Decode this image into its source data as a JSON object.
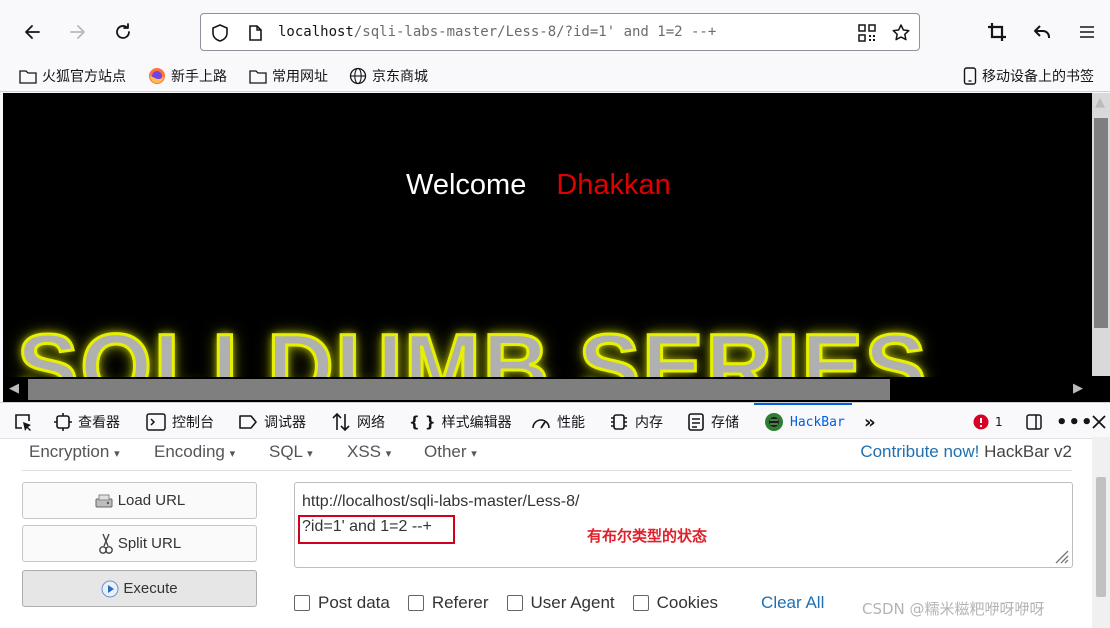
{
  "browser": {
    "url_host": "localhost",
    "url_path": "/sqli-labs-master/Less-8/?id=1' and 1=2 --+"
  },
  "bookmarks": [
    {
      "label": "火狐官方站点",
      "icon": "folder-icon"
    },
    {
      "label": "新手上路",
      "icon": "firefox-icon"
    },
    {
      "label": "常用网址",
      "icon": "folder-icon"
    },
    {
      "label": "京东商城",
      "icon": "globe-icon"
    }
  ],
  "mobile_bookmarks": "移动设备上的书签",
  "page": {
    "welcome": "Welcome",
    "name": "Dhakkan",
    "banner": "SQLI DUMB SERIES"
  },
  "devtools": {
    "tabs": [
      {
        "label": "查看器",
        "icon": "inspector-icon"
      },
      {
        "label": "控制台",
        "icon": "console-icon"
      },
      {
        "label": "调试器",
        "icon": "debugger-icon"
      },
      {
        "label": "网络",
        "icon": "network-icon"
      },
      {
        "label": "样式编辑器",
        "icon": "style-editor-icon"
      },
      {
        "label": "性能",
        "icon": "performance-icon"
      },
      {
        "label": "内存",
        "icon": "memory-icon"
      },
      {
        "label": "存储",
        "icon": "storage-icon"
      },
      {
        "label": "HackBar",
        "icon": "hackbar-icon"
      }
    ],
    "error_count": "1"
  },
  "hackbar": {
    "menus": [
      "Encryption",
      "Encoding",
      "SQL",
      "XSS",
      "Other"
    ],
    "contribute": "Contribute now!",
    "version": "HackBar v2",
    "buttons": {
      "load": "Load URL",
      "split": "Split URL",
      "execute": "Execute"
    },
    "url_line1": "http://localhost/sqli-labs-master/Less-8/",
    "url_line2": "?id=1' and 1=2 --+",
    "note": "有布尔类型的状态",
    "options": [
      "Post data",
      "Referer",
      "User Agent",
      "Cookies"
    ],
    "clear_all": "Clear All"
  },
  "watermark": "CSDN @糯米糍粑咿呀咿呀",
  "colors": {
    "accent": "#0061e0",
    "highlight": "#d0021b",
    "name": "#e00000"
  }
}
